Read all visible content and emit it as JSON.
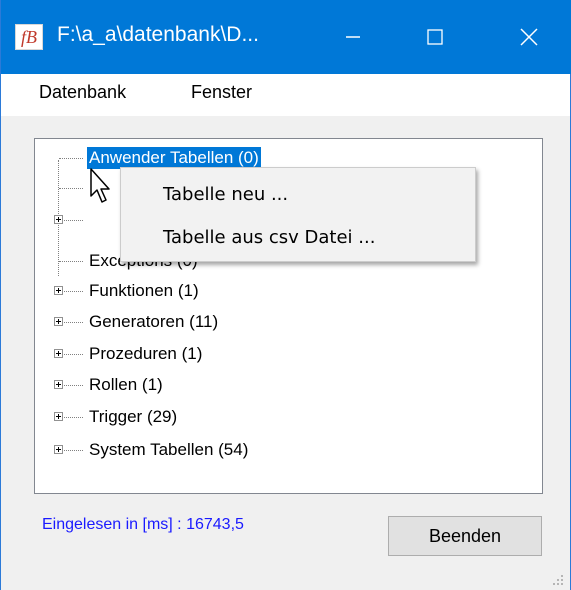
{
  "window": {
    "title": "F:\\a_a\\datenbank\\D...",
    "app_icon_text": "fB"
  },
  "menubar": {
    "items": [
      "Datenbank",
      "Fenster"
    ]
  },
  "tree": {
    "nodes": [
      {
        "label": "Anwender Tabellen (0)",
        "expandable": false,
        "selected": true
      },
      {
        "label": "",
        "expandable": false
      },
      {
        "label": "",
        "expandable": true
      },
      {
        "label": "Exceptions (0)",
        "expandable": false
      },
      {
        "label": "Funktionen (1)",
        "expandable": true
      },
      {
        "label": "Generatoren (11)",
        "expandable": true
      },
      {
        "label": "Prozeduren (1)",
        "expandable": true
      },
      {
        "label": "Rollen (1)",
        "expandable": true
      },
      {
        "label": "Trigger (29)",
        "expandable": true
      },
      {
        "label": "System Tabellen (54)",
        "expandable": true
      }
    ]
  },
  "context_menu": {
    "items": [
      "Tabelle neu ...",
      "Tabelle aus csv Datei ..."
    ]
  },
  "status": {
    "text": "Eingelesen in [ms] : 16743,5"
  },
  "buttons": {
    "quit_label": "Beenden"
  },
  "colors": {
    "titlebar": "#0078d7",
    "selection": "#0078d7",
    "status_text": "#1a1aff"
  }
}
